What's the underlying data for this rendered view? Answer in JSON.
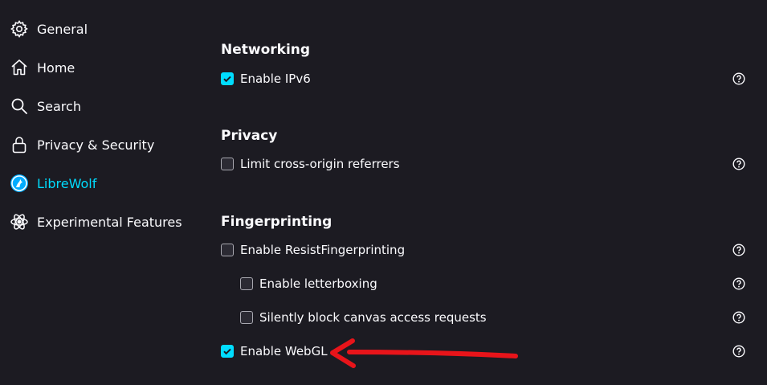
{
  "sidebar": {
    "items": [
      {
        "label": "General",
        "icon": "gear-icon",
        "selected": false
      },
      {
        "label": "Home",
        "icon": "home-icon",
        "selected": false
      },
      {
        "label": "Search",
        "icon": "search-icon",
        "selected": false
      },
      {
        "label": "Privacy & Security",
        "icon": "lock-icon",
        "selected": false
      },
      {
        "label": "LibreWolf",
        "icon": "librewolf-icon",
        "selected": true
      },
      {
        "label": "Experimental Features",
        "icon": "atom-icon",
        "selected": false
      }
    ]
  },
  "main": {
    "sections": [
      {
        "title": "Networking",
        "options": [
          {
            "label": "Enable IPv6",
            "checked": true,
            "indent": false
          }
        ]
      },
      {
        "title": "Privacy",
        "options": [
          {
            "label": "Limit cross-origin referrers",
            "checked": false,
            "indent": false
          }
        ]
      },
      {
        "title": "Fingerprinting",
        "options": [
          {
            "label": "Enable ResistFingerprinting",
            "checked": false,
            "indent": false
          },
          {
            "label": "Enable letterboxing",
            "checked": false,
            "indent": true
          },
          {
            "label": "Silently block canvas access requests",
            "checked": false,
            "indent": true
          },
          {
            "label": "Enable WebGL",
            "checked": true,
            "indent": false
          }
        ]
      }
    ]
  },
  "colors": {
    "background": "#1c1b22",
    "accent": "#00ddff",
    "text": "#fbfbfe",
    "annotation_arrow": "#e8141a"
  }
}
